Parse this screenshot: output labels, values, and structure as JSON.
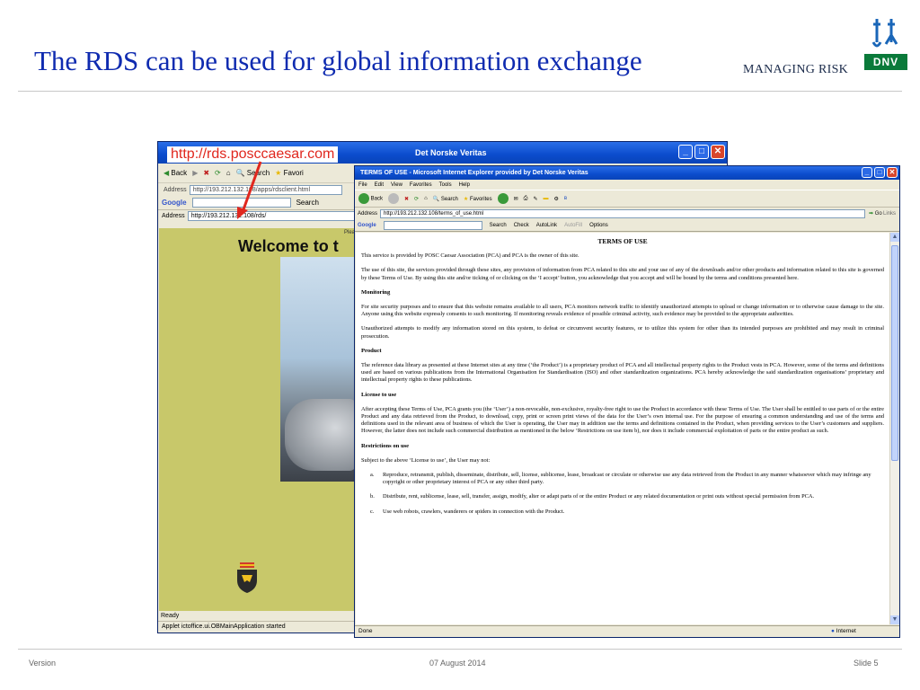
{
  "slide": {
    "title": "The RDS can be used for global information exchange",
    "tagline": "MANAGING RISK",
    "logo_text": "DNV",
    "footer": {
      "version": "Version",
      "date": "07 August 2014",
      "slide_number": "Slide 5"
    },
    "callout": "http://rds.posccaesar.com"
  },
  "back_window": {
    "title": "Det Norske Veritas",
    "toolbar": [
      "Back",
      "Search",
      "Favori"
    ],
    "address_label": "Address",
    "address1": "http://193.212.132.108/apps/rdsclient.html",
    "google_label": "Google",
    "search_label": "Search",
    "address2": "http://193.212.132.108/rds/",
    "page_hint": "Plea",
    "welcome": "Welcome to t",
    "status_ready": "Ready",
    "status_applet": "Applet ictoffice.ui.OBMainApplication started"
  },
  "front_window": {
    "title": "TERMS OF USE - Microsoft Internet Explorer provided by Det Norske Veritas",
    "menu": [
      "File",
      "Edit",
      "View",
      "Favorites",
      "Tools",
      "Help"
    ],
    "toolbar": [
      "Back",
      "Search",
      "Favorites"
    ],
    "address_label": "Address",
    "address": "http://193.212.132.108/terms_of_use.html",
    "go": "Go",
    "links": "Links",
    "google_label": "Google",
    "google_tools": [
      "Search",
      "Check",
      "AutoLink",
      "AutoFill",
      "Options"
    ],
    "status_done": "Done",
    "status_zone": "Internet"
  },
  "document": {
    "title": "TERMS OF USE",
    "intro": "This service is provided by POSC Caesar Association (PCA) and PCA is the owner of this site.",
    "p1": "The use of this site, the services provided through these sites, any provision of information from PCA related to this site and your use of any of the downloads and/or other products and information related to this site is governed by these Terms of Use. By using this site and/or ticking of or clicking on the ‘I accept’ button, you acknowledge that you accept and will be bound by the terms and conditions presented here.",
    "h_monitoring": "Monitoring",
    "p_monitoring": "For site security purposes and to ensure that this website remains available to all users, PCA monitors network traffic to identify unauthorized attempts to upload or change information or to otherwise cause damage to the site. Anyone using this website expressly consents to such monitoring. If monitoring reveals evidence of possible criminal activity, such evidence may be provided to the appropriate authorities.",
    "p_unauth": "Unauthorized attempts to modify any information stored on this system, to defeat or circumvent security features, or to utilize this system for other than its intended purposes are prohibited and may result in criminal prosecution.",
    "h_product": "Product",
    "p_product": "The reference data library as presented at these Internet sites at any time (‘the Product’) is a proprietary product of PCA and all intellectual property rights to the Product vests in PCA. However, some of the terms and definitions used are based on various publications from the International Organisation for Standardisation (ISO) and other standardization organizations. PCA hereby acknowledge the said standardization organisations’ proprietary and intellectual property rights to these publications.",
    "h_license": "License to use",
    "p_license": "After accepting these Terms of Use, PCA grants you (the ‘User’) a non-revocable, non-exclusive, royalty-free right to use the Product in accordance with these Terms of Use. The User shall be entitled to use parts of or the entire Product and any data retrieved from the Product, to download, copy, print or screen print views of the data for the User’s own internal use. For the purpose of ensuring a common understanding and use of the terms and definitions used in the relevant area of business of which the User is operating, the User may in addition use the terms and definitions contained in the Product, when providing services to the User’s customers and suppliers. However, the latter does not include such commercial distribution as mentioned in the below ‘Restrictions on use item b), nor does it include commercial exploitation of parts or the entire product as such.",
    "h_restrictions": "Restrictions on use",
    "p_restrictions": "Subject to the above ‘License to use’, the User may not:",
    "items": [
      {
        "marker": "a.",
        "text": "Reproduce, retransmit, publish, disseminate, distribute, sell, license, sublicense, lease, broadcast or circulate or otherwise use any data retrieved from the Product in any manner whatsoever which may infringe any copyright or other proprietary interest of PCA or any other third party."
      },
      {
        "marker": "b.",
        "text": "Distribute, rent, sublicense, lease, sell, transfer, assign, modify, alter or adapt parts of or the entire Product or any related documentation or print outs without special permission from PCA."
      },
      {
        "marker": "c.",
        "text": "Use web robots, crawlers, wanderers or spiders in connection with the Product."
      }
    ]
  },
  "colors": {
    "title_blue": "#0f2bb0",
    "callout_red": "#e0271e",
    "applet_bg": "#c8c86a",
    "dnv_green": "#0a7a3a"
  }
}
